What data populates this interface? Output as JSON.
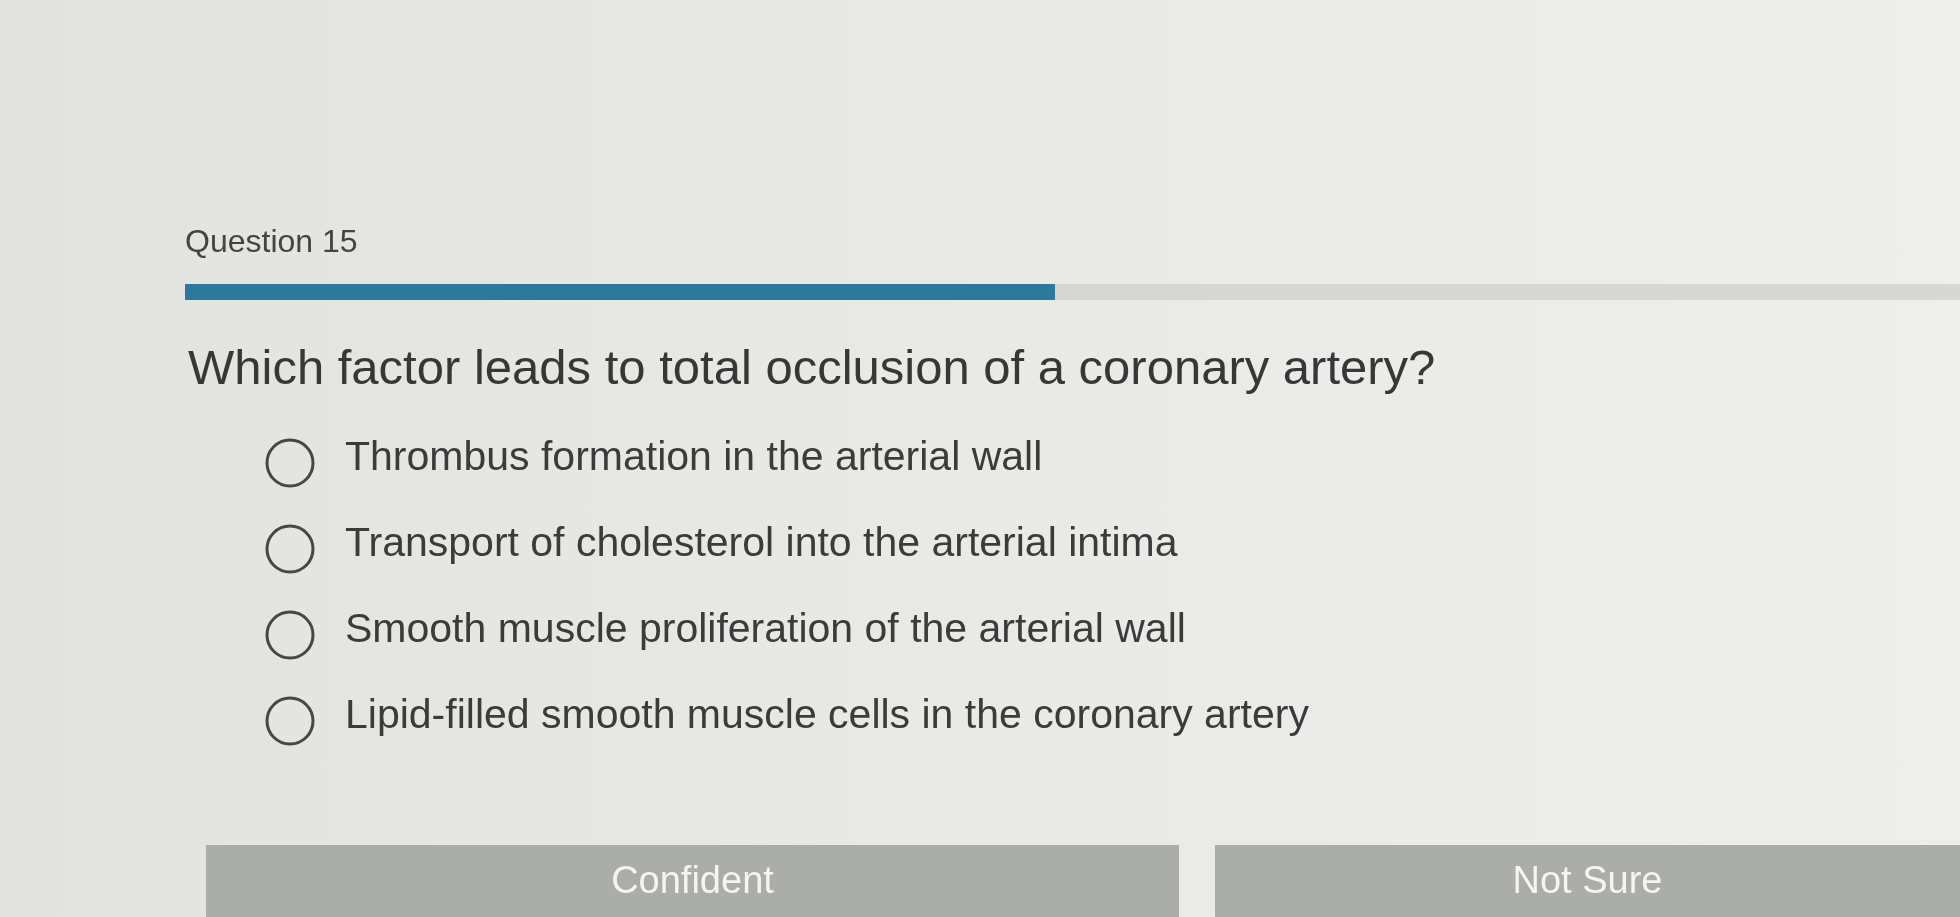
{
  "question": {
    "label": "Question 15",
    "progress": {
      "level": 0.49
    },
    "text": "Which factor leads to total occlusion of a coronary artery?",
    "options": [
      {
        "label": "Thrombus formation in the arterial wall",
        "selected": false
      },
      {
        "label": "Transport of cholesterol into the arterial intima",
        "selected": false
      },
      {
        "label": "Smooth muscle proliferation of the arterial wall",
        "selected": false
      },
      {
        "label": "Lipid-filled smooth muscle cells in the coronary artery",
        "selected": false
      }
    ]
  },
  "buttons": [
    "Confident",
    "Not Sure"
  ]
}
